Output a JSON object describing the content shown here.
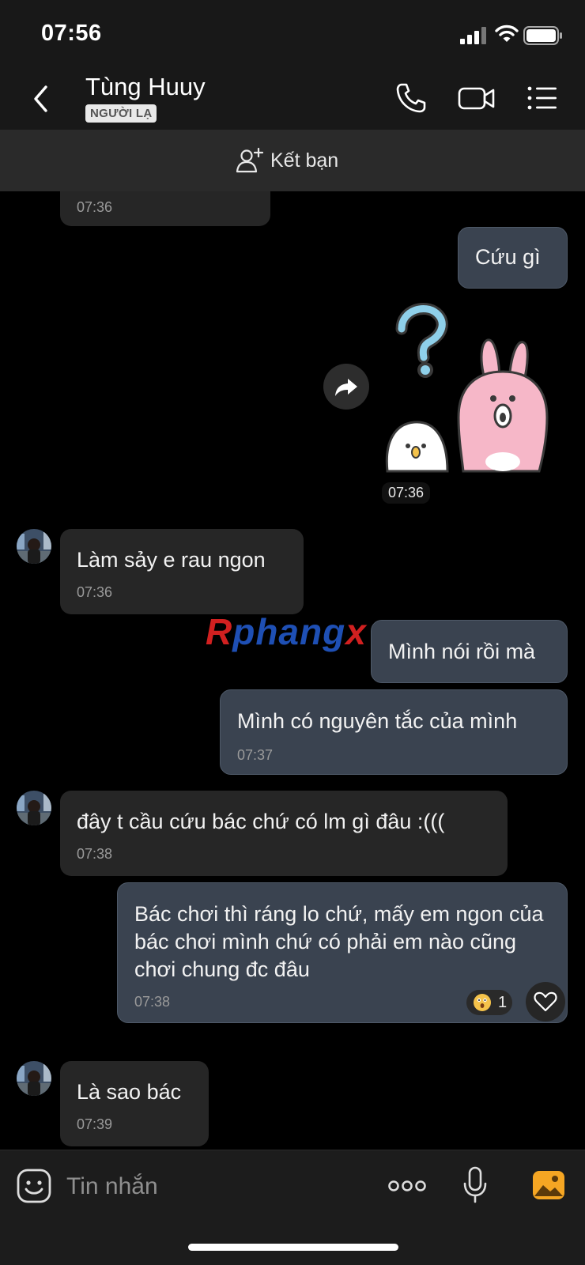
{
  "status_bar": {
    "time": "07:56"
  },
  "header": {
    "contact_name": "Tùng Huuy",
    "badge": "NGƯỜI LẠ"
  },
  "add_friend": {
    "label": "Kết bạn"
  },
  "watermark": {
    "r": "R",
    "mid": "phang",
    "x": "x"
  },
  "messages": [
    {
      "dir": "in",
      "text": "",
      "time": "07:36"
    },
    {
      "dir": "out",
      "text": "Cứu gì",
      "time": ""
    },
    {
      "dir": "out",
      "type": "sticker",
      "sticker": "pink-rabbit-question-sticker",
      "time": "07:36"
    },
    {
      "dir": "in",
      "text": "Làm sảy e rau ngon",
      "time": "07:36"
    },
    {
      "dir": "out",
      "text": "Mình nói rồi mà",
      "time": ""
    },
    {
      "dir": "out",
      "text": "Mình có nguyên tắc của mình",
      "time": "07:37"
    },
    {
      "dir": "in",
      "text": "đây t cầu cứu bác chứ có lm gì đâu :(((",
      "time": "07:38"
    },
    {
      "dir": "out",
      "text": "Bác chơi thì ráng lo chứ, mấy em ngon của bác chơi mình chứ có phải em nào cũng chơi chung đc đâu",
      "time": "07:38",
      "reaction": {
        "emoji": "surprised-emoji",
        "count": "1"
      }
    },
    {
      "dir": "in",
      "text": "Là sao bác",
      "time": "07:39"
    }
  ],
  "input": {
    "placeholder": "Tin nhắn"
  },
  "colors": {
    "bg": "#000000",
    "bubble_in": "#262626",
    "bubble_out": "#3a4350",
    "photo_icon": "#f5a623"
  }
}
